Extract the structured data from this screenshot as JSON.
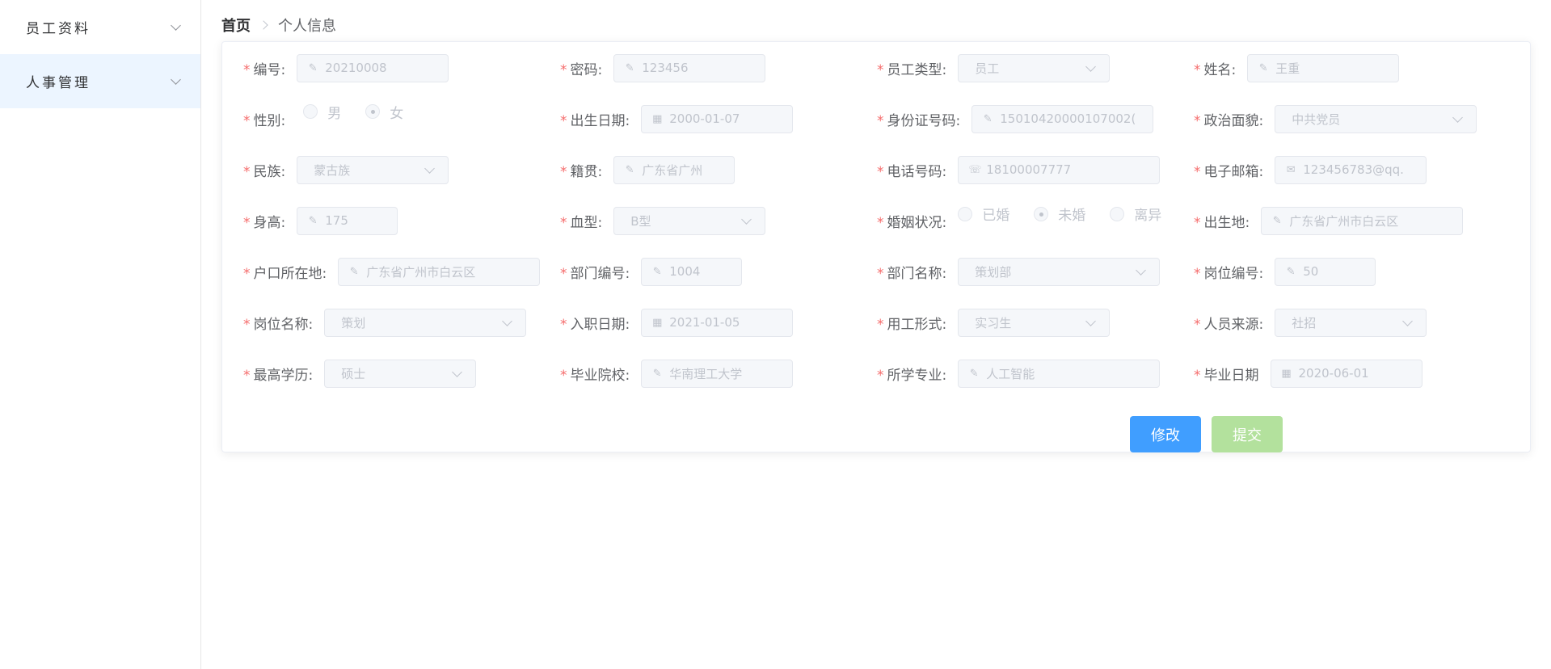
{
  "sidebar": {
    "items": [
      {
        "label": "员工资料"
      },
      {
        "label": "人事管理"
      }
    ]
  },
  "breadcrumb": {
    "home": "首页",
    "current": "个人信息"
  },
  "form": {
    "emp_no": {
      "label": "编号:",
      "value": "20210008",
      "icon": "edit-icon"
    },
    "password": {
      "label": "密码:",
      "value": "123456",
      "icon": "edit-icon"
    },
    "emp_type": {
      "label": "员工类型:",
      "value": "员工"
    },
    "name": {
      "label": "姓名:",
      "value": "王重",
      "icon": "edit-icon"
    },
    "gender": {
      "label": "性别:",
      "options": [
        "男",
        "女"
      ],
      "selected": "女"
    },
    "birth_date": {
      "label": "出生日期:",
      "value": "2000-01-07",
      "icon": "calendar-icon"
    },
    "id_card": {
      "label": "身份证号码:",
      "value": "15010420000107002(",
      "icon": "edit-icon"
    },
    "political": {
      "label": "政治面貌:",
      "value": "中共党员"
    },
    "ethnicity": {
      "label": "民族:",
      "value": "蒙古族"
    },
    "native_place": {
      "label": "籍贯:",
      "value": "广东省广州",
      "icon": "edit-icon"
    },
    "phone": {
      "label": "电话号码:",
      "value": "18100007777",
      "icon": "phone-icon"
    },
    "email": {
      "label": "电子邮箱:",
      "value": "123456783@qq.",
      "icon": "mail-icon"
    },
    "height": {
      "label": "身高:",
      "value": "175",
      "icon": "edit-icon"
    },
    "blood_type": {
      "label": "血型:",
      "value": "B型"
    },
    "marital": {
      "label": "婚姻状况:",
      "options": [
        "已婚",
        "未婚",
        "离异"
      ],
      "selected": "未婚"
    },
    "birthplace": {
      "label": "出生地:",
      "value": "广东省广州市白云区",
      "icon": "edit-icon"
    },
    "hukou": {
      "label": "户口所在地:",
      "value": "广东省广州市白云区",
      "icon": "edit-icon"
    },
    "dept_no": {
      "label": "部门编号:",
      "value": "1004",
      "icon": "edit-icon"
    },
    "dept_name": {
      "label": "部门名称:",
      "value": "策划部"
    },
    "post_no": {
      "label": "岗位编号:",
      "value": "50",
      "icon": "edit-icon"
    },
    "post_name": {
      "label": "岗位名称:",
      "value": "策划"
    },
    "hire_date": {
      "label": "入职日期:",
      "value": "2021-01-05",
      "icon": "calendar-icon"
    },
    "employment_form": {
      "label": "用工形式:",
      "value": "实习生"
    },
    "source": {
      "label": "人员来源:",
      "value": "社招"
    },
    "education": {
      "label": "最高学历:",
      "value": "硕士"
    },
    "school": {
      "label": "毕业院校:",
      "value": "华南理工大学",
      "icon": "edit-icon"
    },
    "major": {
      "label": "所学专业:",
      "value": "人工智能",
      "icon": "edit-icon"
    },
    "grad_date": {
      "label": "毕业日期",
      "value": "2020-06-01",
      "icon": "calendar-icon"
    }
  },
  "buttons": {
    "edit": "修改",
    "submit": "提交"
  },
  "colors": {
    "primary": "#409eff",
    "success_disabled": "#b3e19d",
    "required": "#f56c6c",
    "active_menu_bg": "#ecf5ff"
  }
}
